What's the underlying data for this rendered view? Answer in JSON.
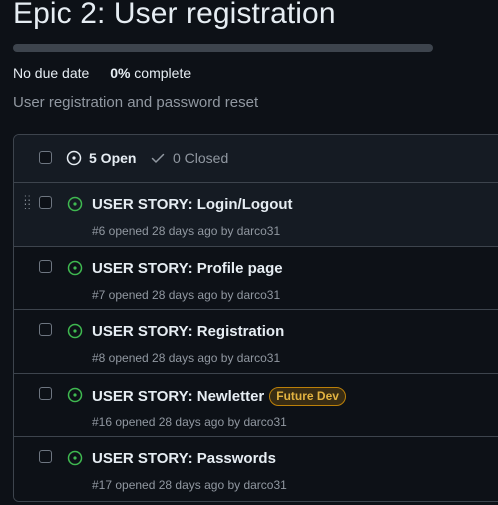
{
  "milestone": {
    "title": "Epic 2: User registration",
    "progress_percent": 0,
    "due": "No due date",
    "percent_value": "0%",
    "percent_suffix": " complete",
    "description": "User registration and password reset"
  },
  "filters": {
    "open_label": "5 Open",
    "closed_label": "0 Closed"
  },
  "colors": {
    "open_green": "#3fb950",
    "label_gold": "#e3b341"
  },
  "issues": [
    {
      "title": "USER STORY: Login/Logout",
      "meta": "#6 opened 28 days ago by darco31",
      "label": ""
    },
    {
      "title": "USER STORY: Profile page",
      "meta": "#7 opened 28 days ago by darco31",
      "label": ""
    },
    {
      "title": "USER STORY: Registration",
      "meta": "#8 opened 28 days ago by darco31",
      "label": ""
    },
    {
      "title": "USER STORY: Newletter",
      "meta": "#16 opened 28 days ago by darco31",
      "label": "Future Dev"
    },
    {
      "title": "USER STORY: Passwords",
      "meta": "#17 opened 28 days ago by darco31",
      "label": ""
    }
  ]
}
